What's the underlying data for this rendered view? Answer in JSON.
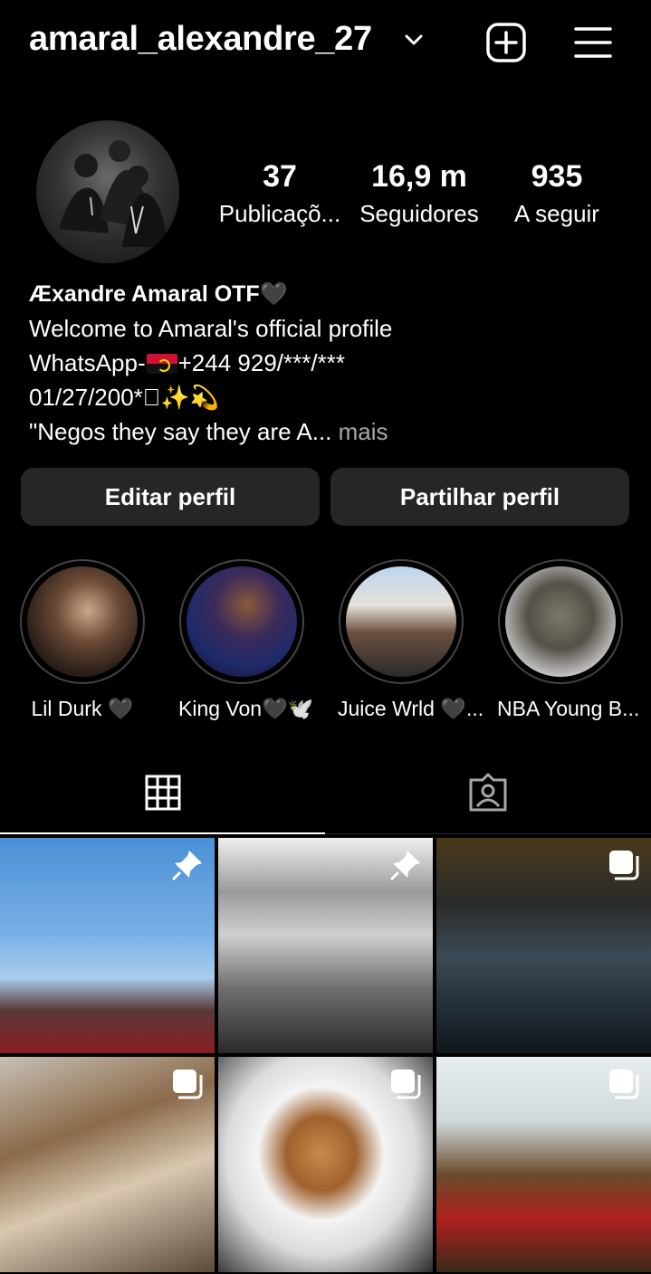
{
  "header": {
    "username": "amaral_alexandre_27"
  },
  "stats": [
    {
      "value": "37",
      "label": "Publicaçõ..."
    },
    {
      "value": "16,9 m",
      "label": "Seguidores"
    },
    {
      "value": "935",
      "label": "A seguir"
    }
  ],
  "bio": {
    "name": "Æxandre Amaral OTF🖤",
    "line1": "Welcome to Amaral's official profile",
    "line2_prefix": "WhatsApp-",
    "line2_suffix": "+244 929/***/***",
    "line3": "01/27/200*\u0000✨💫",
    "line4": "\"Negos they say they are A...",
    "more": " mais"
  },
  "buttons": {
    "edit": "Editar perfil",
    "share": "Partilhar perfil"
  },
  "highlights": [
    {
      "label": "Lil Durk 🖤"
    },
    {
      "label": "King Von🖤🕊️"
    },
    {
      "label": "Juice Wrld 🖤..."
    },
    {
      "label": "NBA Young B..."
    }
  ],
  "tabs": [
    {
      "icon": "grid-icon",
      "active": true
    },
    {
      "icon": "tagged-icon",
      "active": false
    }
  ],
  "posts": [
    {
      "badge": "pin-icon"
    },
    {
      "badge": "pin-icon"
    },
    {
      "badge": "multiple-icon"
    },
    {
      "badge": "multiple-icon"
    },
    {
      "badge": "multiple-icon"
    },
    {
      "badge": "multiple-icon"
    }
  ],
  "colors": {
    "background": "#000000",
    "button": "#262626",
    "muted": "#a8a8a8"
  }
}
